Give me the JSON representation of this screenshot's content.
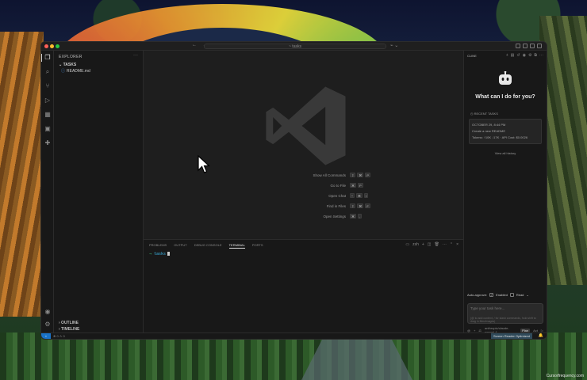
{
  "window": {
    "command_center": "~ tasks",
    "copilot_badge": "⌁ ⌄"
  },
  "activity_bar": [
    "files-icon",
    "search-icon",
    "source-control-icon",
    "run-debug-icon",
    "extensions-icon",
    "remote-explorer-icon",
    "cline-icon",
    "account-icon",
    "settings-icon"
  ],
  "sidebar": {
    "title": "EXPLORER",
    "more": "···",
    "folder": "⌄ TASKS",
    "file": "README.md",
    "outline": "› OUTLINE",
    "timeline": "› TIMELINE"
  },
  "editor": {
    "shortcuts": [
      {
        "label": "Show All Commands",
        "keys": [
          "⇧",
          "⌘",
          "P"
        ]
      },
      {
        "label": "Go to File",
        "keys": [
          "⌘",
          "P"
        ]
      },
      {
        "label": "Open Chat",
        "keys": [
          "^",
          "⌘",
          "I"
        ]
      },
      {
        "label": "Find in Files",
        "keys": [
          "⇧",
          "⌘",
          "F"
        ]
      },
      {
        "label": "Open Settings",
        "keys": [
          "⌘",
          ","
        ]
      }
    ]
  },
  "panel": {
    "tabs": [
      "PROBLEMS",
      "OUTPUT",
      "DEBUG CONSOLE",
      "TERMINAL",
      "PORTS"
    ],
    "active_tab": "TERMINAL",
    "shell": "zsh",
    "prompt_arrow": "→",
    "prompt_dir": "tasks"
  },
  "chat": {
    "header": "CLINE",
    "question": "What can I do for you?",
    "recent_label": "RECENT TASKS",
    "task_date": "OCTOBER 29, 8:44 PM",
    "task_text": "Create a new README",
    "task_meta": "Tokens: ↑10K ↓17K · API Cost: $0.0026",
    "view_history": "View all history",
    "auto_approve_label": "Auto-approve:",
    "auto_approve_enabled": "Enabled",
    "auto_approve_read": "Read",
    "input_placeholder": "Type your task here...",
    "input_hint": "(@ to add context, / for slash commands, hold shift to drag in files/images)",
    "model": "anthropic/claude-sonnet-4",
    "plan": "Plan",
    "act": "Act"
  },
  "statusbar": {
    "left": "⊗ 0 ⚠ 0",
    "right": "Screen Reader Optimized"
  },
  "watermark": "Cursorfrequency.com"
}
